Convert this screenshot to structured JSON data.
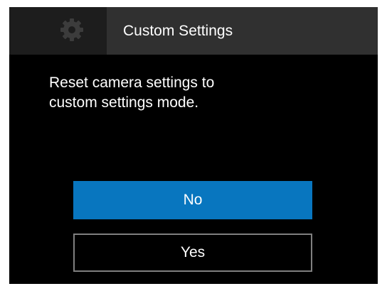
{
  "header": {
    "icon": "gear-icon",
    "title": "Custom Settings"
  },
  "dialog": {
    "message_line1": "Reset camera settings to",
    "message_line2": "custom settings mode."
  },
  "buttons": {
    "no_label": "No",
    "yes_label": "Yes",
    "selected": "No"
  },
  "colors": {
    "background": "#000000",
    "header": "#303030",
    "icon_tab": "#1d1d1d",
    "selected_button": "#0876bf",
    "button_border": "#7f7f7f",
    "text": "#ffffff"
  }
}
